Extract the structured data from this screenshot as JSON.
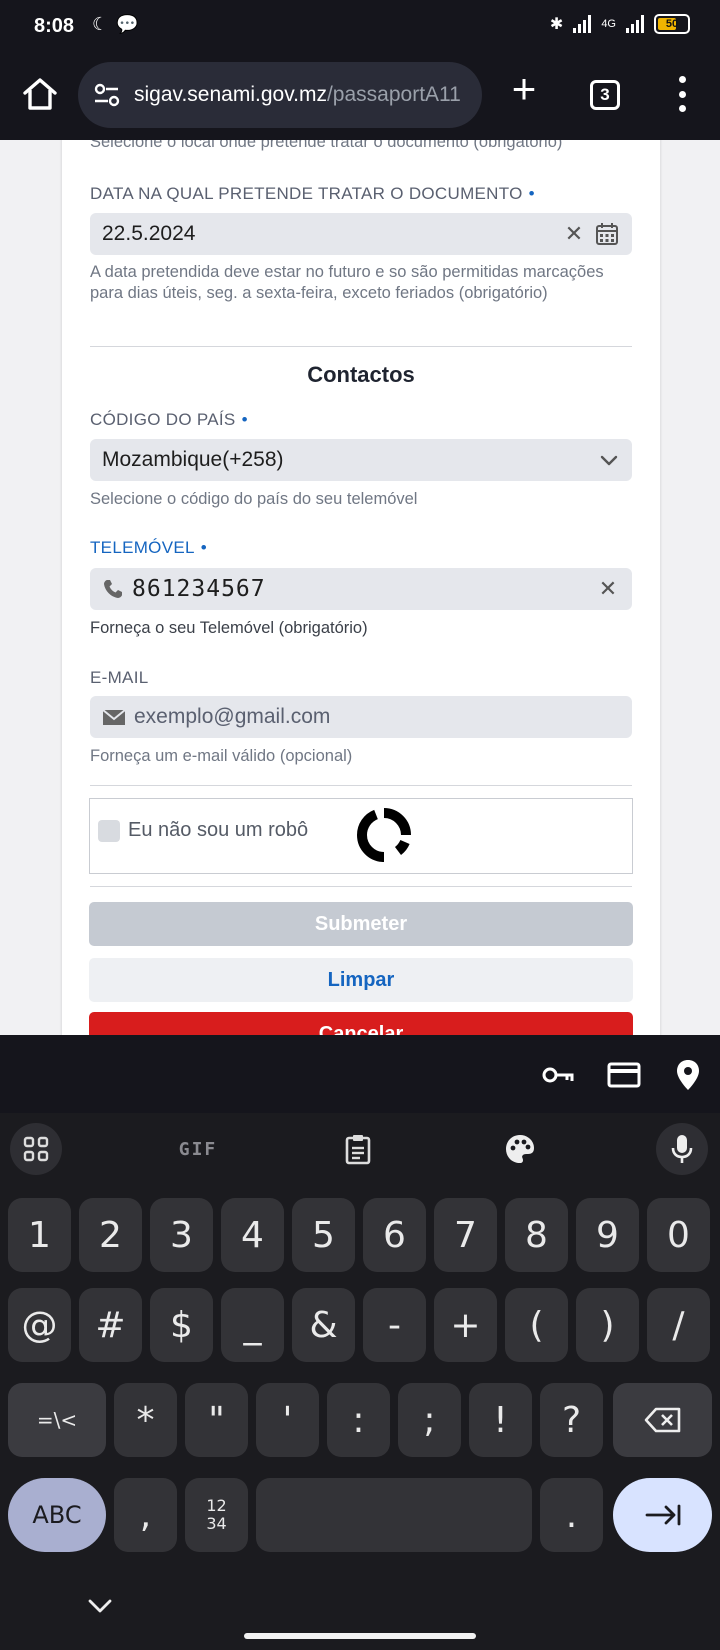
{
  "status": {
    "time": "8:08",
    "network": "4G",
    "battery": "50"
  },
  "browser": {
    "url_domain": "sigav.senami.gov.mz",
    "url_path": "/passaportA11",
    "tab_count": "3"
  },
  "form": {
    "prev_hint": "Selecione o local onde pretende tratar o documento (obrigatório)",
    "date": {
      "label": "DATA NA QUAL PRETENDE TRATAR O DOCUMENTO",
      "required_mark": "•",
      "value": "22.5.2024",
      "hint": "A data pretendida deve estar no futuro e so são permitidas marcações para dias úteis, seg. a sexta-feira, exceto feriados (obrigatório)"
    },
    "contacts_title": "Contactos",
    "country": {
      "label": "CÓDIGO DO PAÍS",
      "required_mark": "•",
      "value": "Mozambique(+258)",
      "hint": "Selecione o código do país do seu telemóvel"
    },
    "phone": {
      "label": "TELEMÓVEL",
      "required_mark": "•",
      "value": "861234567",
      "hint": "Forneça o seu Telemóvel (obrigatório)"
    },
    "email": {
      "label": "E-MAIL",
      "placeholder": "exemplo@gmail.com",
      "hint": "Forneça um e-mail válido (opcional)"
    },
    "captcha_label": "Eu não sou um robô",
    "submit_label": "Submeter",
    "clear_label": "Limpar",
    "cancel_label": "Cancelar"
  },
  "keyboard": {
    "toolbar": {
      "gif_label": "GIF"
    },
    "row1": [
      "1",
      "2",
      "3",
      "4",
      "5",
      "6",
      "7",
      "8",
      "9",
      "0"
    ],
    "row2": [
      "@",
      "#",
      "$",
      "_",
      "&",
      "-",
      "+",
      "(",
      ")",
      "/"
    ],
    "row3": {
      "more_label": "=\\<",
      "keys": [
        "*",
        "\"",
        "'",
        ":",
        ";",
        "!",
        "?"
      ]
    },
    "row4": {
      "abc_label": "ABC",
      "comma": ",",
      "numpad_label_top": "12",
      "numpad_label_bottom": "34",
      "period": "."
    }
  },
  "colors": {
    "accent": "#1565c0",
    "cancel": "#d81d1d",
    "submit_disabled": "#c5cad2"
  }
}
